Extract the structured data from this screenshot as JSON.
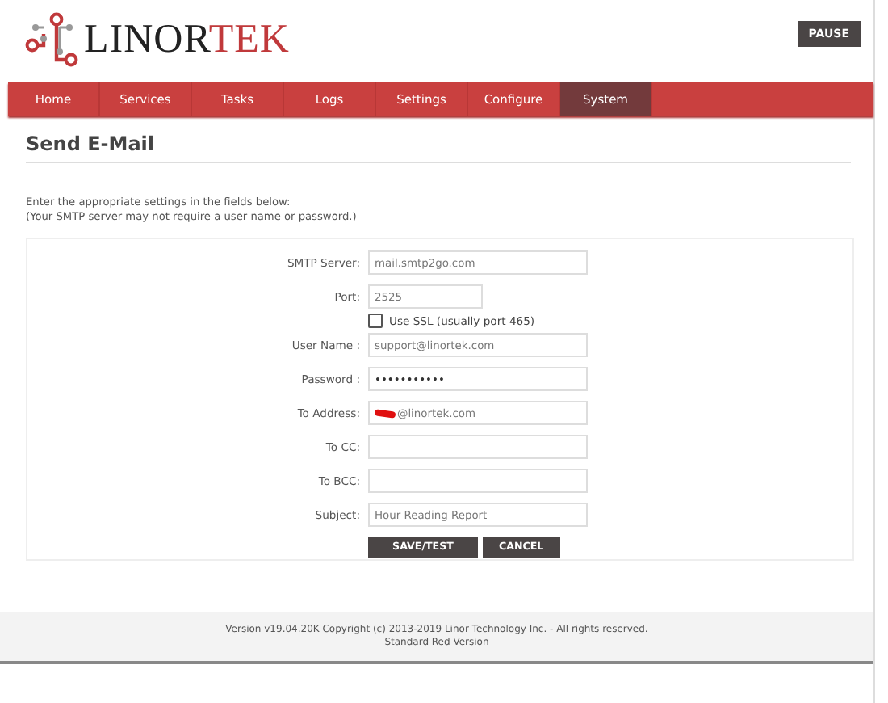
{
  "header": {
    "brand_dark": "LINOR",
    "brand_red": "TEK",
    "pause_button": "PAUSE"
  },
  "nav": [
    {
      "label": "Home",
      "selected": false
    },
    {
      "label": "Services",
      "selected": false
    },
    {
      "label": "Tasks",
      "selected": false
    },
    {
      "label": "Logs",
      "selected": false
    },
    {
      "label": "Settings",
      "selected": false
    },
    {
      "label": "Configure",
      "selected": false
    },
    {
      "label": "System",
      "selected": true
    }
  ],
  "page_title": "Send E-Mail",
  "intro": [
    "Enter the appropriate settings in the fields below:",
    "(Your SMTP server may not require a user name or password.)"
  ],
  "fields": [
    {
      "kind": "text",
      "label": "SMTP Server:",
      "value": "mail.smtp2go.com"
    },
    {
      "kind": "short_text",
      "label": "Port:",
      "value": "2525"
    },
    {
      "kind": "checkbox",
      "label": "Use SSL (usually port 465)",
      "checked": false
    },
    {
      "kind": "text",
      "label": "User Name :",
      "value": "support@linortek.com"
    },
    {
      "kind": "text",
      "label": "Password :",
      "value": "•••••••••••",
      "secret": true
    },
    {
      "kind": "text",
      "label": "To Address:",
      "value": "@linortek.com",
      "redacted": true
    },
    {
      "kind": "text",
      "label": "To CC:"
    },
    {
      "kind": "text",
      "label": "To BCC:"
    },
    {
      "kind": "text",
      "label": "Subject:",
      "value": "Hour Reading Report"
    }
  ],
  "buttons": [
    "SAVE/TEST",
    "CANCEL"
  ],
  "footer": [
    "Version v19.04.20K Copyright (c) 2013-2019 Linor Technology Inc. - All rights reserved.",
    "Standard Red Version"
  ]
}
